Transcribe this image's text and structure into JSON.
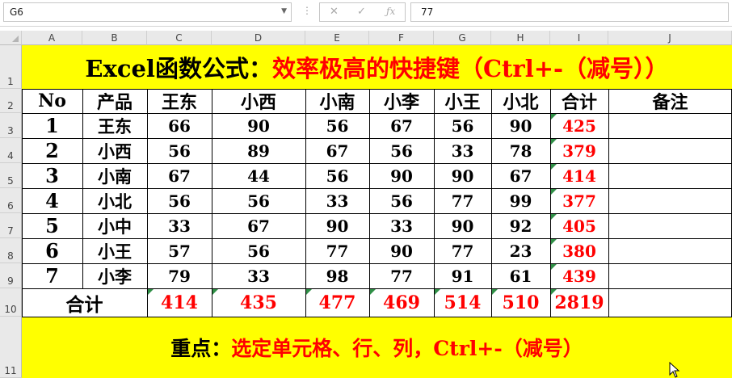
{
  "formula_bar": {
    "name_box": "G6",
    "formula_value": "77",
    "icons": [
      "cancel-icon",
      "enter-icon",
      "fx-icon"
    ]
  },
  "columns": [
    "A",
    "B",
    "C",
    "D",
    "E",
    "F",
    "G",
    "H",
    "I",
    "J"
  ],
  "row_numbers": [
    "1",
    "2",
    "3",
    "4",
    "5",
    "6",
    "7",
    "8",
    "9",
    "10",
    "11"
  ],
  "title": {
    "part1": "Excel函数公式：",
    "part2": "效率极高的快捷键（Ctrl+-（减号））"
  },
  "table": {
    "headers": [
      "No",
      "产品",
      "王东",
      "小西",
      "小南",
      "小李",
      "小王",
      "小北",
      "合计",
      "备注"
    ],
    "rows": [
      {
        "no": "1",
        "name": "王东",
        "values": [
          "66",
          "90",
          "56",
          "67",
          "56",
          "90"
        ],
        "total": "425"
      },
      {
        "no": "2",
        "name": "小西",
        "values": [
          "56",
          "89",
          "67",
          "56",
          "33",
          "78"
        ],
        "total": "379"
      },
      {
        "no": "3",
        "name": "小南",
        "values": [
          "67",
          "44",
          "56",
          "90",
          "90",
          "67"
        ],
        "total": "414"
      },
      {
        "no": "4",
        "name": "小北",
        "values": [
          "56",
          "56",
          "33",
          "56",
          "77",
          "99"
        ],
        "total": "377"
      },
      {
        "no": "5",
        "name": "小中",
        "values": [
          "33",
          "67",
          "90",
          "33",
          "90",
          "92"
        ],
        "total": "405"
      },
      {
        "no": "6",
        "name": "小王",
        "values": [
          "57",
          "56",
          "77",
          "90",
          "77",
          "23"
        ],
        "total": "380"
      },
      {
        "no": "7",
        "name": "小李",
        "values": [
          "79",
          "33",
          "98",
          "77",
          "91",
          "61"
        ],
        "total": "439"
      }
    ],
    "total_row": {
      "label": "合计",
      "values": [
        "414",
        "435",
        "477",
        "469",
        "514",
        "510"
      ],
      "grand": "2819"
    }
  },
  "footer": {
    "part1": "重点：",
    "part2": "选定单元格、行、列，Ctrl+-（减号）"
  },
  "colors": {
    "title_band": "#ffff00",
    "accent_red": "#ff0000",
    "error_marker": "#2f8f46"
  }
}
